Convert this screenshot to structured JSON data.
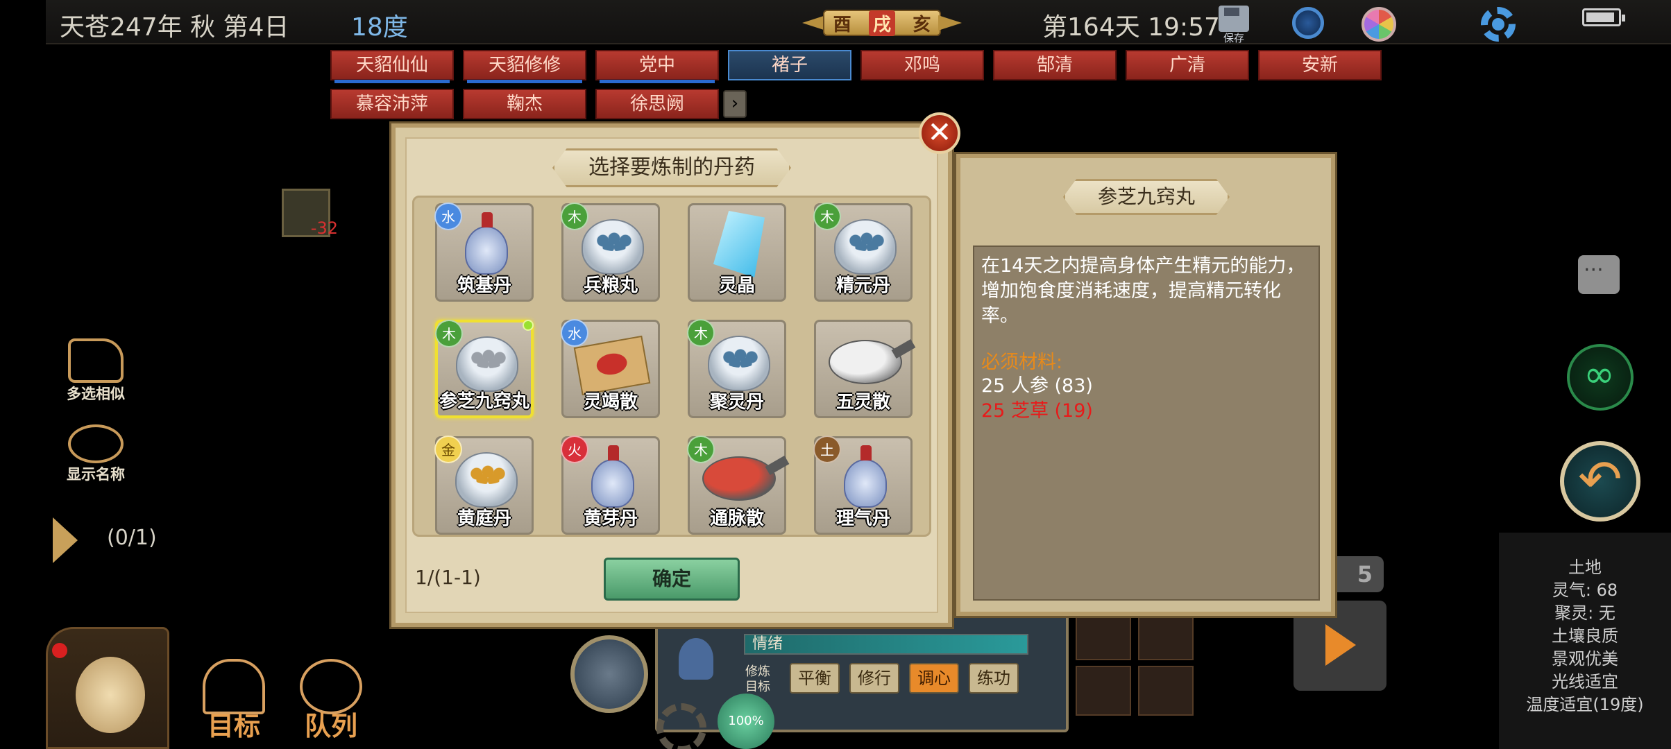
{
  "topbar": {
    "date": "天苍247年 秋 第4日",
    "temperature": "18度",
    "zodiac": [
      "酉",
      "戌",
      "亥"
    ],
    "day_time": "第164天 19:57",
    "save_label": "保存"
  },
  "name_tabs": [
    {
      "label": "天貂仙仙",
      "selected": false
    },
    {
      "label": "天貂修修",
      "selected": false
    },
    {
      "label": "党中",
      "selected": false
    },
    {
      "label": "褚子",
      "selected": true
    },
    {
      "label": "邓鸣",
      "selected": false
    },
    {
      "label": "郜清",
      "selected": false
    },
    {
      "label": "广清",
      "selected": false
    },
    {
      "label": "安新",
      "selected": false
    },
    {
      "label": "慕容沛萍",
      "selected": false
    },
    {
      "label": "鞠杰",
      "selected": false
    },
    {
      "label": "徐思阙",
      "selected": false
    }
  ],
  "left": {
    "small_icon_value": "-32",
    "multi_select": "多选相似",
    "show_names": "显示名称",
    "progress": "(0/1)",
    "nav_target": "目标",
    "nav_team": "队列"
  },
  "dialog": {
    "title": "选择要炼制的丹药",
    "pills": [
      {
        "name": "筑基丹",
        "element": "水",
        "el": "water",
        "pic": "vase",
        "selected": false
      },
      {
        "name": "兵粮丸",
        "element": "木",
        "el": "wood",
        "pic": "bowl-blue",
        "selected": false
      },
      {
        "name": "灵晶",
        "element": "",
        "el": "",
        "pic": "crystal",
        "selected": false
      },
      {
        "name": "精元丹",
        "element": "木",
        "el": "wood",
        "pic": "bowl-blue",
        "selected": false
      },
      {
        "name": "参芝九窍丸",
        "element": "木",
        "el": "wood",
        "pic": "bowl-grey",
        "selected": true
      },
      {
        "name": "灵竭散",
        "element": "水",
        "el": "water",
        "pic": "cloth",
        "selected": false
      },
      {
        "name": "聚灵丹",
        "element": "木",
        "el": "wood",
        "pic": "bowl-blue",
        "selected": false
      },
      {
        "name": "五灵散",
        "element": "",
        "el": "",
        "pic": "spoon-white",
        "selected": false
      },
      {
        "name": "黄庭丹",
        "element": "金",
        "el": "metal",
        "pic": "bowl-gold",
        "selected": false
      },
      {
        "name": "黄芽丹",
        "element": "火",
        "el": "fire",
        "pic": "vase",
        "selected": false
      },
      {
        "name": "通脉散",
        "element": "木",
        "el": "wood",
        "pic": "spoon-red",
        "selected": false
      },
      {
        "name": "理气丹",
        "element": "土",
        "el": "earth",
        "pic": "vase",
        "selected": false
      }
    ],
    "page": "1/(1-1)",
    "confirm": "确定"
  },
  "detail": {
    "title": "参芝九窍丸",
    "description": "在14天之内提高身体产生精元的能力，增加饱食度消耗速度，提高精元转化率。",
    "materials_heading": "必须材料:",
    "materials": [
      {
        "text": "25 人参 (83)",
        "sufficient": true
      },
      {
        "text": "25 芝草 (19)",
        "sufficient": false
      }
    ]
  },
  "cultivation": {
    "mood": "情绪",
    "target_label": "修炼目标",
    "options": [
      {
        "label": "平衡",
        "selected": false
      },
      {
        "label": "修行",
        "selected": false
      },
      {
        "label": "调心",
        "selected": true
      },
      {
        "label": "练功",
        "selected": false
      }
    ],
    "percent": "100%"
  },
  "level_badge": "5",
  "terrain": {
    "title": "土地",
    "lines": [
      "灵气: 68",
      "聚灵: 无",
      "土壤良质",
      "景观优美",
      "光线适宜",
      "温度适宜(19度)"
    ]
  },
  "colors": {
    "panel_parchment": "#e2d6b6",
    "tab_red": "#b83a30",
    "tab_selected": "#2b4a6a",
    "lacking_red": "#e81a1a",
    "heading_orange": "#e88a1a",
    "confirm_green": "#6ab887"
  }
}
